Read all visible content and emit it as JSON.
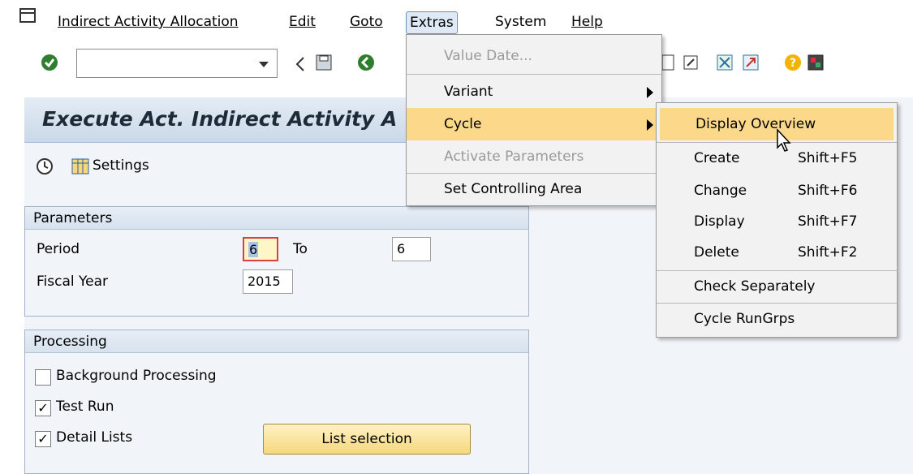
{
  "menubar": {
    "items": [
      {
        "label": "Indirect Activity Allocation"
      },
      {
        "label": "Edit"
      },
      {
        "label": "Goto"
      },
      {
        "label": "Extras"
      },
      {
        "label": "System"
      },
      {
        "label": "Help"
      }
    ]
  },
  "page": {
    "title": "Execute Act. Indirect Activity A",
    "settings_label": "Settings"
  },
  "parameters": {
    "heading": "Parameters",
    "period_label": "Period",
    "period_from": "6",
    "to_label": "To",
    "period_to": "6",
    "fiscal_year_label": "Fiscal Year",
    "fiscal_year": "2015"
  },
  "processing": {
    "heading": "Processing",
    "background_label": "Background Processing",
    "background_checked": false,
    "test_run_label": "Test Run",
    "test_run_checked": true,
    "detail_lists_label": "Detail Lists",
    "detail_lists_checked": true,
    "list_selection_label": "List selection"
  },
  "extras_menu": {
    "items": [
      {
        "label": "Value Date...",
        "disabled": true
      },
      {
        "label": "Variant",
        "submenu": true
      },
      {
        "label": "Cycle",
        "submenu": true,
        "highlighted": true
      },
      {
        "label": "Activate Parameters",
        "disabled": true
      },
      {
        "label": "Set Controlling Area"
      }
    ]
  },
  "cycle_menu": {
    "items": [
      {
        "label": "Display Overview",
        "shortcut": "",
        "highlighted": true
      },
      {
        "label": "Create",
        "shortcut": "Shift+F5"
      },
      {
        "label": "Change",
        "shortcut": "Shift+F6"
      },
      {
        "label": "Display",
        "shortcut": "Shift+F7"
      },
      {
        "label": "Delete",
        "shortcut": "Shift+F2"
      },
      {
        "label": "Check Separately",
        "shortcut": ""
      },
      {
        "label": "Cycle RunGrps",
        "shortcut": ""
      }
    ]
  },
  "colors": {
    "highlight": "#fcd98a",
    "panel_bg": "#f1f4f8",
    "group_border": "#9fb4cb",
    "button_bg": "#f5d77c"
  },
  "icons": {
    "menu_icon": "window-menu-icon",
    "enter": "enter-check-icon",
    "back": "back-arrow-icon",
    "save": "save-icon",
    "execute": "execute-clock-icon",
    "settings": "settings-table-icon",
    "help": "help-icon",
    "cursor": "mouse-cursor-icon"
  }
}
